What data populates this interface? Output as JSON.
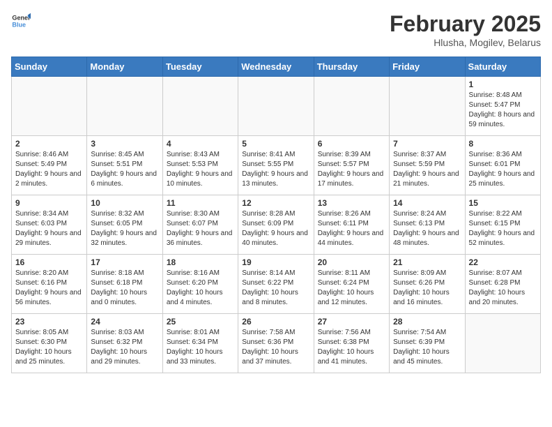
{
  "header": {
    "logo_line1": "General",
    "logo_line2": "Blue",
    "month": "February 2025",
    "location": "Hlusha, Mogilev, Belarus"
  },
  "days_of_week": [
    "Sunday",
    "Monday",
    "Tuesday",
    "Wednesday",
    "Thursday",
    "Friday",
    "Saturday"
  ],
  "weeks": [
    [
      {
        "day": "",
        "info": ""
      },
      {
        "day": "",
        "info": ""
      },
      {
        "day": "",
        "info": ""
      },
      {
        "day": "",
        "info": ""
      },
      {
        "day": "",
        "info": ""
      },
      {
        "day": "",
        "info": ""
      },
      {
        "day": "1",
        "info": "Sunrise: 8:48 AM\nSunset: 5:47 PM\nDaylight: 8 hours and 59 minutes."
      }
    ],
    [
      {
        "day": "2",
        "info": "Sunrise: 8:46 AM\nSunset: 5:49 PM\nDaylight: 9 hours and 2 minutes."
      },
      {
        "day": "3",
        "info": "Sunrise: 8:45 AM\nSunset: 5:51 PM\nDaylight: 9 hours and 6 minutes."
      },
      {
        "day": "4",
        "info": "Sunrise: 8:43 AM\nSunset: 5:53 PM\nDaylight: 9 hours and 10 minutes."
      },
      {
        "day": "5",
        "info": "Sunrise: 8:41 AM\nSunset: 5:55 PM\nDaylight: 9 hours and 13 minutes."
      },
      {
        "day": "6",
        "info": "Sunrise: 8:39 AM\nSunset: 5:57 PM\nDaylight: 9 hours and 17 minutes."
      },
      {
        "day": "7",
        "info": "Sunrise: 8:37 AM\nSunset: 5:59 PM\nDaylight: 9 hours and 21 minutes."
      },
      {
        "day": "8",
        "info": "Sunrise: 8:36 AM\nSunset: 6:01 PM\nDaylight: 9 hours and 25 minutes."
      }
    ],
    [
      {
        "day": "9",
        "info": "Sunrise: 8:34 AM\nSunset: 6:03 PM\nDaylight: 9 hours and 29 minutes."
      },
      {
        "day": "10",
        "info": "Sunrise: 8:32 AM\nSunset: 6:05 PM\nDaylight: 9 hours and 32 minutes."
      },
      {
        "day": "11",
        "info": "Sunrise: 8:30 AM\nSunset: 6:07 PM\nDaylight: 9 hours and 36 minutes."
      },
      {
        "day": "12",
        "info": "Sunrise: 8:28 AM\nSunset: 6:09 PM\nDaylight: 9 hours and 40 minutes."
      },
      {
        "day": "13",
        "info": "Sunrise: 8:26 AM\nSunset: 6:11 PM\nDaylight: 9 hours and 44 minutes."
      },
      {
        "day": "14",
        "info": "Sunrise: 8:24 AM\nSunset: 6:13 PM\nDaylight: 9 hours and 48 minutes."
      },
      {
        "day": "15",
        "info": "Sunrise: 8:22 AM\nSunset: 6:15 PM\nDaylight: 9 hours and 52 minutes."
      }
    ],
    [
      {
        "day": "16",
        "info": "Sunrise: 8:20 AM\nSunset: 6:16 PM\nDaylight: 9 hours and 56 minutes."
      },
      {
        "day": "17",
        "info": "Sunrise: 8:18 AM\nSunset: 6:18 PM\nDaylight: 10 hours and 0 minutes."
      },
      {
        "day": "18",
        "info": "Sunrise: 8:16 AM\nSunset: 6:20 PM\nDaylight: 10 hours and 4 minutes."
      },
      {
        "day": "19",
        "info": "Sunrise: 8:14 AM\nSunset: 6:22 PM\nDaylight: 10 hours and 8 minutes."
      },
      {
        "day": "20",
        "info": "Sunrise: 8:11 AM\nSunset: 6:24 PM\nDaylight: 10 hours and 12 minutes."
      },
      {
        "day": "21",
        "info": "Sunrise: 8:09 AM\nSunset: 6:26 PM\nDaylight: 10 hours and 16 minutes."
      },
      {
        "day": "22",
        "info": "Sunrise: 8:07 AM\nSunset: 6:28 PM\nDaylight: 10 hours and 20 minutes."
      }
    ],
    [
      {
        "day": "23",
        "info": "Sunrise: 8:05 AM\nSunset: 6:30 PM\nDaylight: 10 hours and 25 minutes."
      },
      {
        "day": "24",
        "info": "Sunrise: 8:03 AM\nSunset: 6:32 PM\nDaylight: 10 hours and 29 minutes."
      },
      {
        "day": "25",
        "info": "Sunrise: 8:01 AM\nSunset: 6:34 PM\nDaylight: 10 hours and 33 minutes."
      },
      {
        "day": "26",
        "info": "Sunrise: 7:58 AM\nSunset: 6:36 PM\nDaylight: 10 hours and 37 minutes."
      },
      {
        "day": "27",
        "info": "Sunrise: 7:56 AM\nSunset: 6:38 PM\nDaylight: 10 hours and 41 minutes."
      },
      {
        "day": "28",
        "info": "Sunrise: 7:54 AM\nSunset: 6:39 PM\nDaylight: 10 hours and 45 minutes."
      },
      {
        "day": "",
        "info": ""
      }
    ]
  ]
}
